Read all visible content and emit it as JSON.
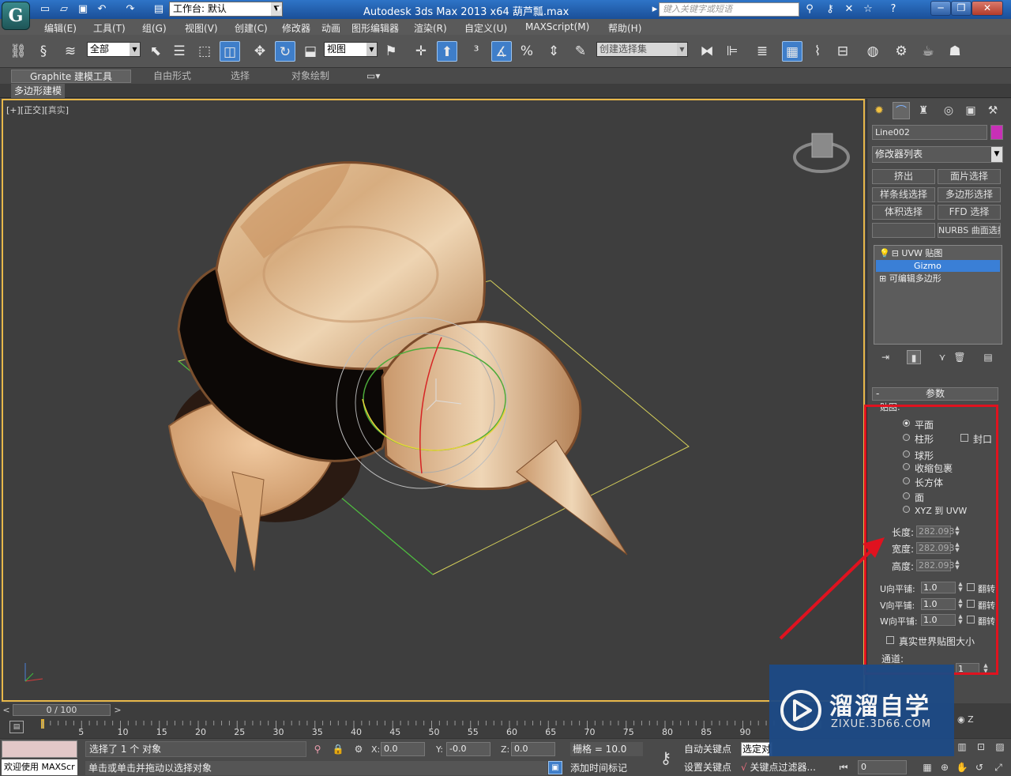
{
  "titlebar": {
    "workspace": "工作台: 默认",
    "title": "Autodesk 3ds Max  2013 x64      葫芦瓢.max",
    "search_placeholder": "键入关键字或短语"
  },
  "menu": [
    "编辑(E)",
    "工具(T)",
    "组(G)",
    "视图(V)",
    "创建(C)",
    "修改器",
    "动画",
    "图形编辑器",
    "渲染(R)",
    "自定义(U)",
    "MAXScript(M)",
    "帮助(H)"
  ],
  "toolbar": {
    "filter": "全部",
    "refcoord": "视图",
    "selset_placeholder": "创建选择集"
  },
  "ribbon": {
    "tabs": [
      "Graphite 建模工具",
      "自由形式",
      "选择",
      "对象绘制"
    ],
    "subtab": "多边形建模"
  },
  "viewport": {
    "label_left": "[+][",
    "label_view": "正交",
    "label_mid": "][",
    "label_shade": "真实",
    "label_right": "]"
  },
  "command_panel": {
    "object_name": "Line002",
    "modifier_list": "修改器列表",
    "modifier_buttons": [
      "挤出",
      "面片选择",
      "样条线选择",
      "多边形选择",
      "体积选择",
      "FFD 选择",
      "",
      "NURBS 曲面选择"
    ],
    "stack": [
      "UVW 贴图",
      "Gizmo",
      "可编辑多边形"
    ],
    "rollout_title": "参数",
    "mapping_label": "贴图:",
    "mapping_options": [
      "平面",
      "柱形",
      "球形",
      "收缩包裹",
      "长方体",
      "面",
      "XYZ 到 UVW"
    ],
    "mapping_selected": "平面",
    "cap_label": "封口",
    "length_label": "长度:",
    "width_label": "宽度:",
    "height_label": "高度:",
    "length": "282.093",
    "width": "282.093",
    "height": "282.093",
    "u_tile_label": "U向平铺:",
    "v_tile_label": "V向平铺:",
    "w_tile_label": "W向平铺:",
    "u_tile": "1.0",
    "v_tile": "1.0",
    "w_tile": "1.0",
    "flip_label": "翻转",
    "real_world_label": "真实世界贴图大小",
    "channel_label": "通道:",
    "channel_value": "1"
  },
  "timeline": {
    "frame_display": "0 / 100",
    "ticks": [
      "0",
      "5",
      "10",
      "15",
      "20",
      "25",
      "30",
      "35",
      "40",
      "45",
      "50",
      "55",
      "60",
      "65",
      "70",
      "75",
      "80",
      "85",
      "90"
    ],
    "current_frame": "0"
  },
  "status": {
    "maxscript_welcome": "欢迎使用 MAXScr",
    "selection": "选择了 1 个 对象",
    "prompt": "单击或单击并拖动以选择对象",
    "x_label": "X:",
    "y_label": "Y:",
    "z_label": "Z:",
    "x": "0.0",
    "y": "-0.0",
    "z": "0.0",
    "grid": "栅格 = 10.0",
    "add_time_tag": "添加时间标记",
    "auto_key": "自动关键点",
    "set_key": "设置关键点",
    "selected_drop": "选定对",
    "key_filters": "关键点过滤器...",
    "z_axis": "Z"
  },
  "watermark": {
    "title": "溜溜自学",
    "url": "ZIXUE.3D66.COM"
  },
  "colors": {
    "highlight": "#e0121f",
    "object_color": "#c830b7",
    "selection_blue": "#3a7fd6"
  }
}
